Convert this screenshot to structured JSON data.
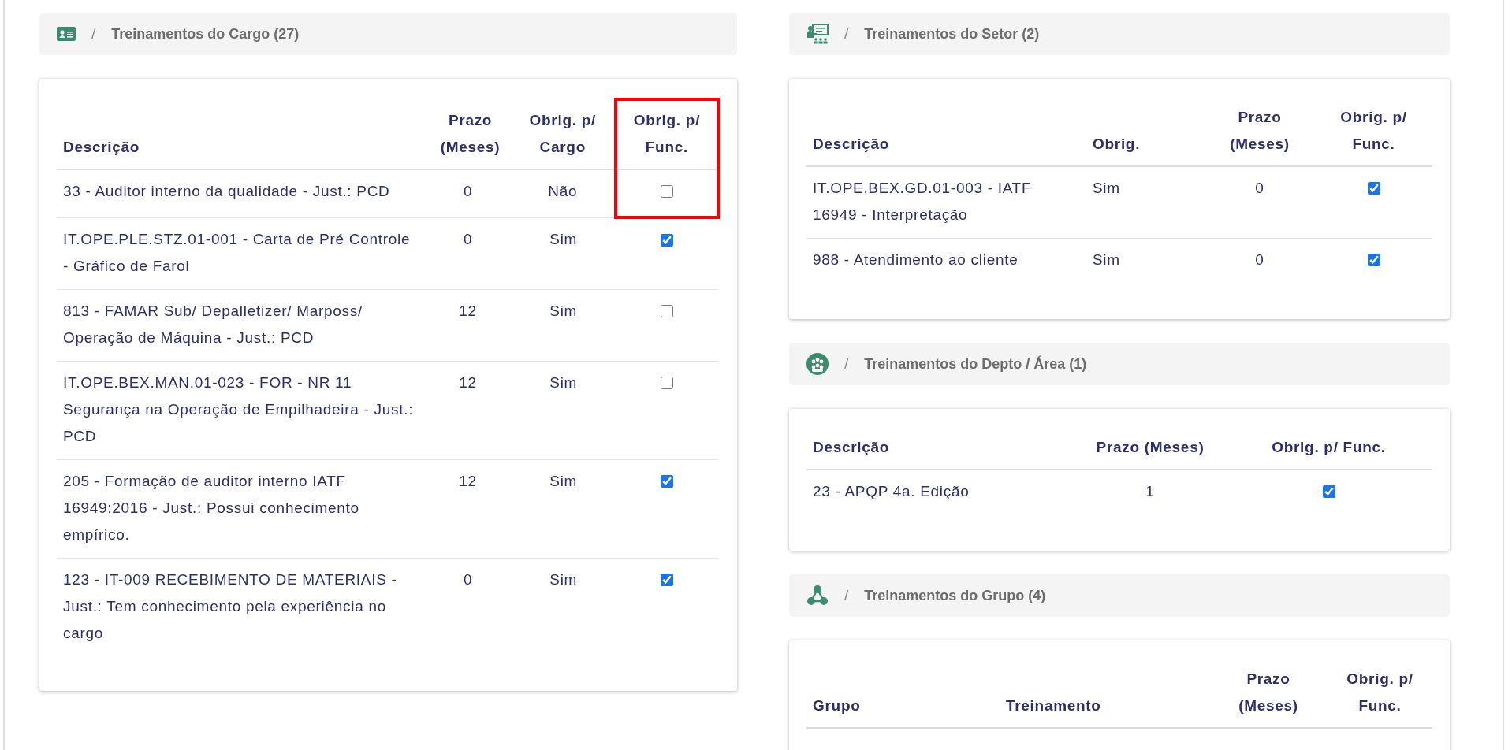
{
  "sections": [
    {
      "separator": "/",
      "title": "Treinamentos do Cargo (27)",
      "table": {
        "columns": [
          {
            "label": "Descrição",
            "kind": "text",
            "highlighted": false
          },
          {
            "label": "Prazo (Meses)",
            "kind": "center",
            "highlighted": false
          },
          {
            "label": "Obrig. p/ Cargo",
            "kind": "center",
            "highlighted": false
          },
          {
            "label": "Obrig. p/ Func.",
            "kind": "check",
            "highlighted": true
          }
        ],
        "rows": [
          {
            "cells": [
              {
                "text": "33 - Auditor interno da qualidade - Just.: PCD"
              },
              {
                "text": "0"
              },
              {
                "text": "Não"
              },
              {
                "checked": false
              }
            ]
          },
          {
            "cells": [
              {
                "text": "IT.OPE.PLE.STZ.01-001 - Carta de Pré Controle - Gráfico de Farol"
              },
              {
                "text": "0"
              },
              {
                "text": "Sim"
              },
              {
                "checked": true
              }
            ]
          },
          {
            "cells": [
              {
                "text": "813 - FAMAR Sub/ Depalletizer/ Marposs/ Operação de Máquina - Just.: PCD"
              },
              {
                "text": "12"
              },
              {
                "text": "Sim"
              },
              {
                "checked": false
              }
            ]
          },
          {
            "cells": [
              {
                "text": "IT.OPE.BEX.MAN.01-023 - FOR - NR 11 Segurança na Operação de Empilhadeira - Just.: PCD"
              },
              {
                "text": "12"
              },
              {
                "text": "Sim"
              },
              {
                "checked": false
              }
            ]
          },
          {
            "cells": [
              {
                "text": "205 - Formação de auditor interno IATF 16949:2016 - Just.: Possui conhecimento empírico."
              },
              {
                "text": "12"
              },
              {
                "text": "Sim"
              },
              {
                "checked": true
              }
            ]
          },
          {
            "cells": [
              {
                "text": "123 - IT-009 RECEBIMENTO DE MATERIAIS - Just.: Tem conhecimento pela experiência no cargo"
              },
              {
                "text": "0"
              },
              {
                "text": "Sim"
              },
              {
                "checked": true
              }
            ]
          }
        ]
      }
    },
    {
      "separator": "/",
      "title": "Treinamentos do Setor (2)",
      "table": {
        "columns": [
          {
            "label": "Descrição",
            "kind": "text",
            "highlighted": false
          },
          {
            "label": "Obrig.",
            "kind": "text",
            "highlighted": false
          },
          {
            "label": "Prazo (Meses)",
            "kind": "center",
            "highlighted": false
          },
          {
            "label": "Obrig. p/ Func.",
            "kind": "check",
            "highlighted": false
          }
        ],
        "rows": [
          {
            "cells": [
              {
                "text": "IT.OPE.BEX.GD.01-003 - IATF 16949 - Interpretação"
              },
              {
                "text": "Sim"
              },
              {
                "text": "0"
              },
              {
                "checked": true
              }
            ]
          },
          {
            "cells": [
              {
                "text": "988 - Atendimento ao cliente"
              },
              {
                "text": "Sim"
              },
              {
                "text": "0"
              },
              {
                "checked": true
              }
            ]
          }
        ]
      }
    },
    {
      "separator": "/",
      "title": "Treinamentos do Depto / Área (1)",
      "table": {
        "columns": [
          {
            "label": "Descrição",
            "kind": "text",
            "highlighted": false
          },
          {
            "label": "Prazo (Meses)",
            "kind": "center",
            "highlighted": false
          },
          {
            "label": "Obrig. p/ Func.",
            "kind": "check",
            "highlighted": false
          }
        ],
        "rows": [
          {
            "cells": [
              {
                "text": "23 - APQP 4a. Edição"
              },
              {
                "text": "1"
              },
              {
                "checked": true
              }
            ]
          }
        ]
      }
    },
    {
      "separator": "/",
      "title": "Treinamentos do Grupo (4)",
      "table": {
        "columns": [
          {
            "label": "Grupo",
            "kind": "text",
            "highlighted": false
          },
          {
            "label": "Treinamento",
            "kind": "text",
            "highlighted": false
          },
          {
            "label": "Prazo (Meses)",
            "kind": "center",
            "highlighted": false
          },
          {
            "label": "Obrig. p/ Func.",
            "kind": "check",
            "highlighted": false
          }
        ]
      }
    }
  ]
}
